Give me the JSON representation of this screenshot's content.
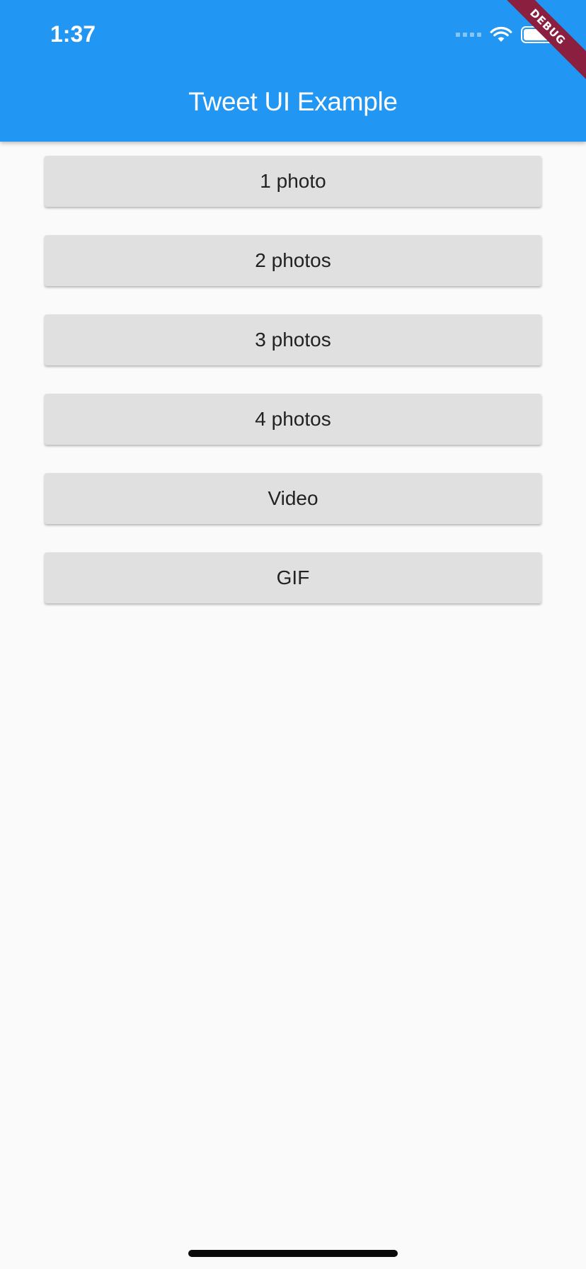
{
  "status_bar": {
    "time": "1:37",
    "icons": [
      "cellular-signal-icon",
      "wifi-icon",
      "battery-icon"
    ]
  },
  "app_bar": {
    "title": "Tweet UI Example",
    "color": "#2196f3"
  },
  "debug_banner": {
    "label": "DEBUG",
    "color": "#8b1f3f"
  },
  "buttons": [
    {
      "label": "1 photo"
    },
    {
      "label": "2 photos"
    },
    {
      "label": "3 photos"
    },
    {
      "label": "4 photos"
    },
    {
      "label": "Video"
    },
    {
      "label": "GIF"
    }
  ]
}
